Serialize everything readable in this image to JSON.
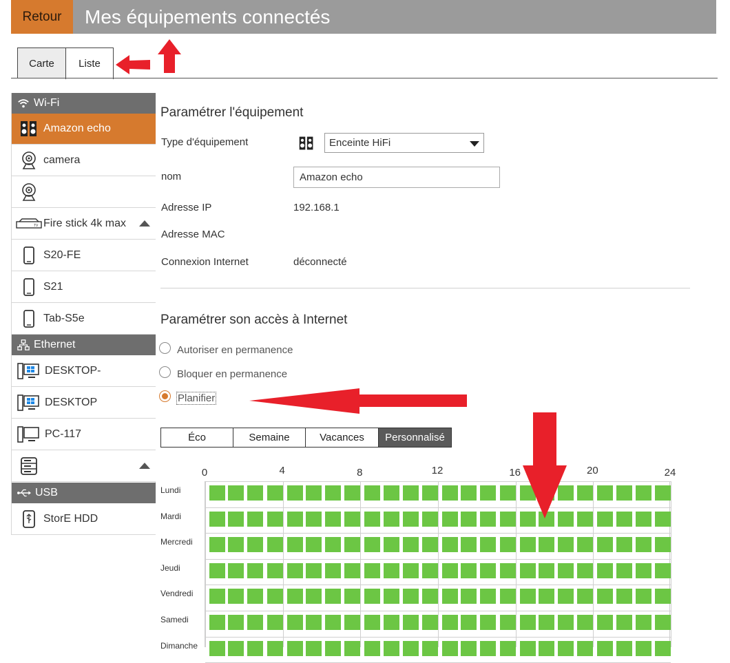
{
  "header": {
    "back_label": "Retour",
    "title": "Mes équipements connectés"
  },
  "tabs": [
    {
      "label": "Carte",
      "active": false
    },
    {
      "label": "Liste",
      "active": true
    }
  ],
  "sidebar": {
    "wifi_header": "Wi-Fi",
    "wifi_items": [
      {
        "label": "Amazon echo",
        "icon": "speaker-icon",
        "active": true
      },
      {
        "label": "camera",
        "icon": "camera-icon"
      },
      {
        "label": "",
        "icon": "camera-icon"
      },
      {
        "label": "Fire stick 4k max",
        "icon": "tv-box-icon",
        "expanded": true
      },
      {
        "label": "S20-FE",
        "icon": "phone-icon"
      },
      {
        "label": "S21",
        "icon": "phone-icon"
      },
      {
        "label": "Tab-S5e",
        "icon": "phone-icon"
      }
    ],
    "ethernet_header": "Ethernet",
    "ethernet_items": [
      {
        "label": "DESKTOP-",
        "icon": "windows-pc-icon"
      },
      {
        "label": "DESKTOP",
        "icon": "windows-pc-icon"
      },
      {
        "label": "PC-117",
        "icon": "pc-icon"
      },
      {
        "label": "",
        "icon": "nas-icon",
        "expanded": true
      }
    ],
    "usb_header": "USB",
    "usb_items": [
      {
        "label": "StorE HDD",
        "icon": "usb-drive-icon"
      }
    ]
  },
  "device_settings": {
    "heading": "Paramétrer l'équipement",
    "type_label": "Type d'équipement",
    "type_value": "Enceinte HiFi",
    "name_label": "nom",
    "name_value": "Amazon echo",
    "ip_label": "Adresse IP",
    "ip_value": "192.168.1",
    "mac_label": "Adresse MAC",
    "mac_value": "",
    "connection_label": "Connexion Internet",
    "connection_value": "déconnecté"
  },
  "internet_access": {
    "heading": "Paramétrer son accès à Internet",
    "options": [
      {
        "label": "Autoriser en permanence",
        "selected": false
      },
      {
        "label": "Bloquer en permanence",
        "selected": false
      },
      {
        "label": "Planifier",
        "selected": true
      }
    ],
    "modes": [
      "Éco",
      "Semaine",
      "Vacances",
      "Personnalisé"
    ],
    "active_mode": "Personnalisé"
  },
  "schedule": {
    "hour_labels": [
      "0",
      "4",
      "8",
      "12",
      "16",
      "20",
      "24"
    ],
    "days": [
      "Lundi",
      "Mardi",
      "Mercredi",
      "Jeudi",
      "Vendredi",
      "Samedi",
      "Dimanche"
    ],
    "slots_per_day": 24,
    "allowed_color": "#6cc644"
  },
  "colors": {
    "accent": "#d67a2e",
    "header_gray": "#9b9b9b",
    "sidebar_header": "#6e6e6e",
    "annotation_arrow": "#e8202a"
  }
}
